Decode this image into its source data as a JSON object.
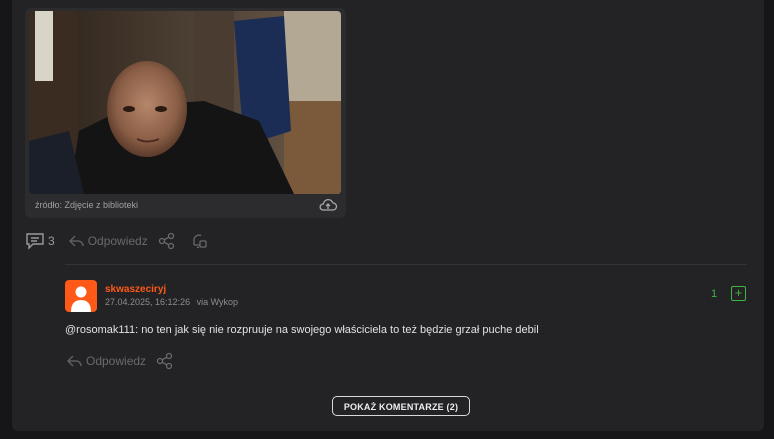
{
  "entry": {
    "media_source": "źródło: Zdjęcie z biblioteki",
    "comments_count": "3",
    "reply_label": "Odpowiedz"
  },
  "comment": {
    "username": "skwaszeciryj",
    "timestamp": "27.04.2025, 16:12:26",
    "via": "via Wykop",
    "votes": "1",
    "plus_label": "+",
    "mention": "@rosomak111",
    "text": ": no ten jak się nie rozpruuje na swojego właściciela to też będzie grzał puche debil",
    "reply_label": "Odpowiedz"
  },
  "show_comments_label": "POKAŻ KOMENTARZE (2)",
  "colors": {
    "accent": "#ff5917",
    "vote_green": "#3eb541",
    "background": "#161618",
    "card": "#232325"
  },
  "icons": [
    "comments-icon",
    "reply-icon",
    "share-icon",
    "notify-icon",
    "upload-cloud-icon",
    "avatar-placeholder-icon"
  ]
}
